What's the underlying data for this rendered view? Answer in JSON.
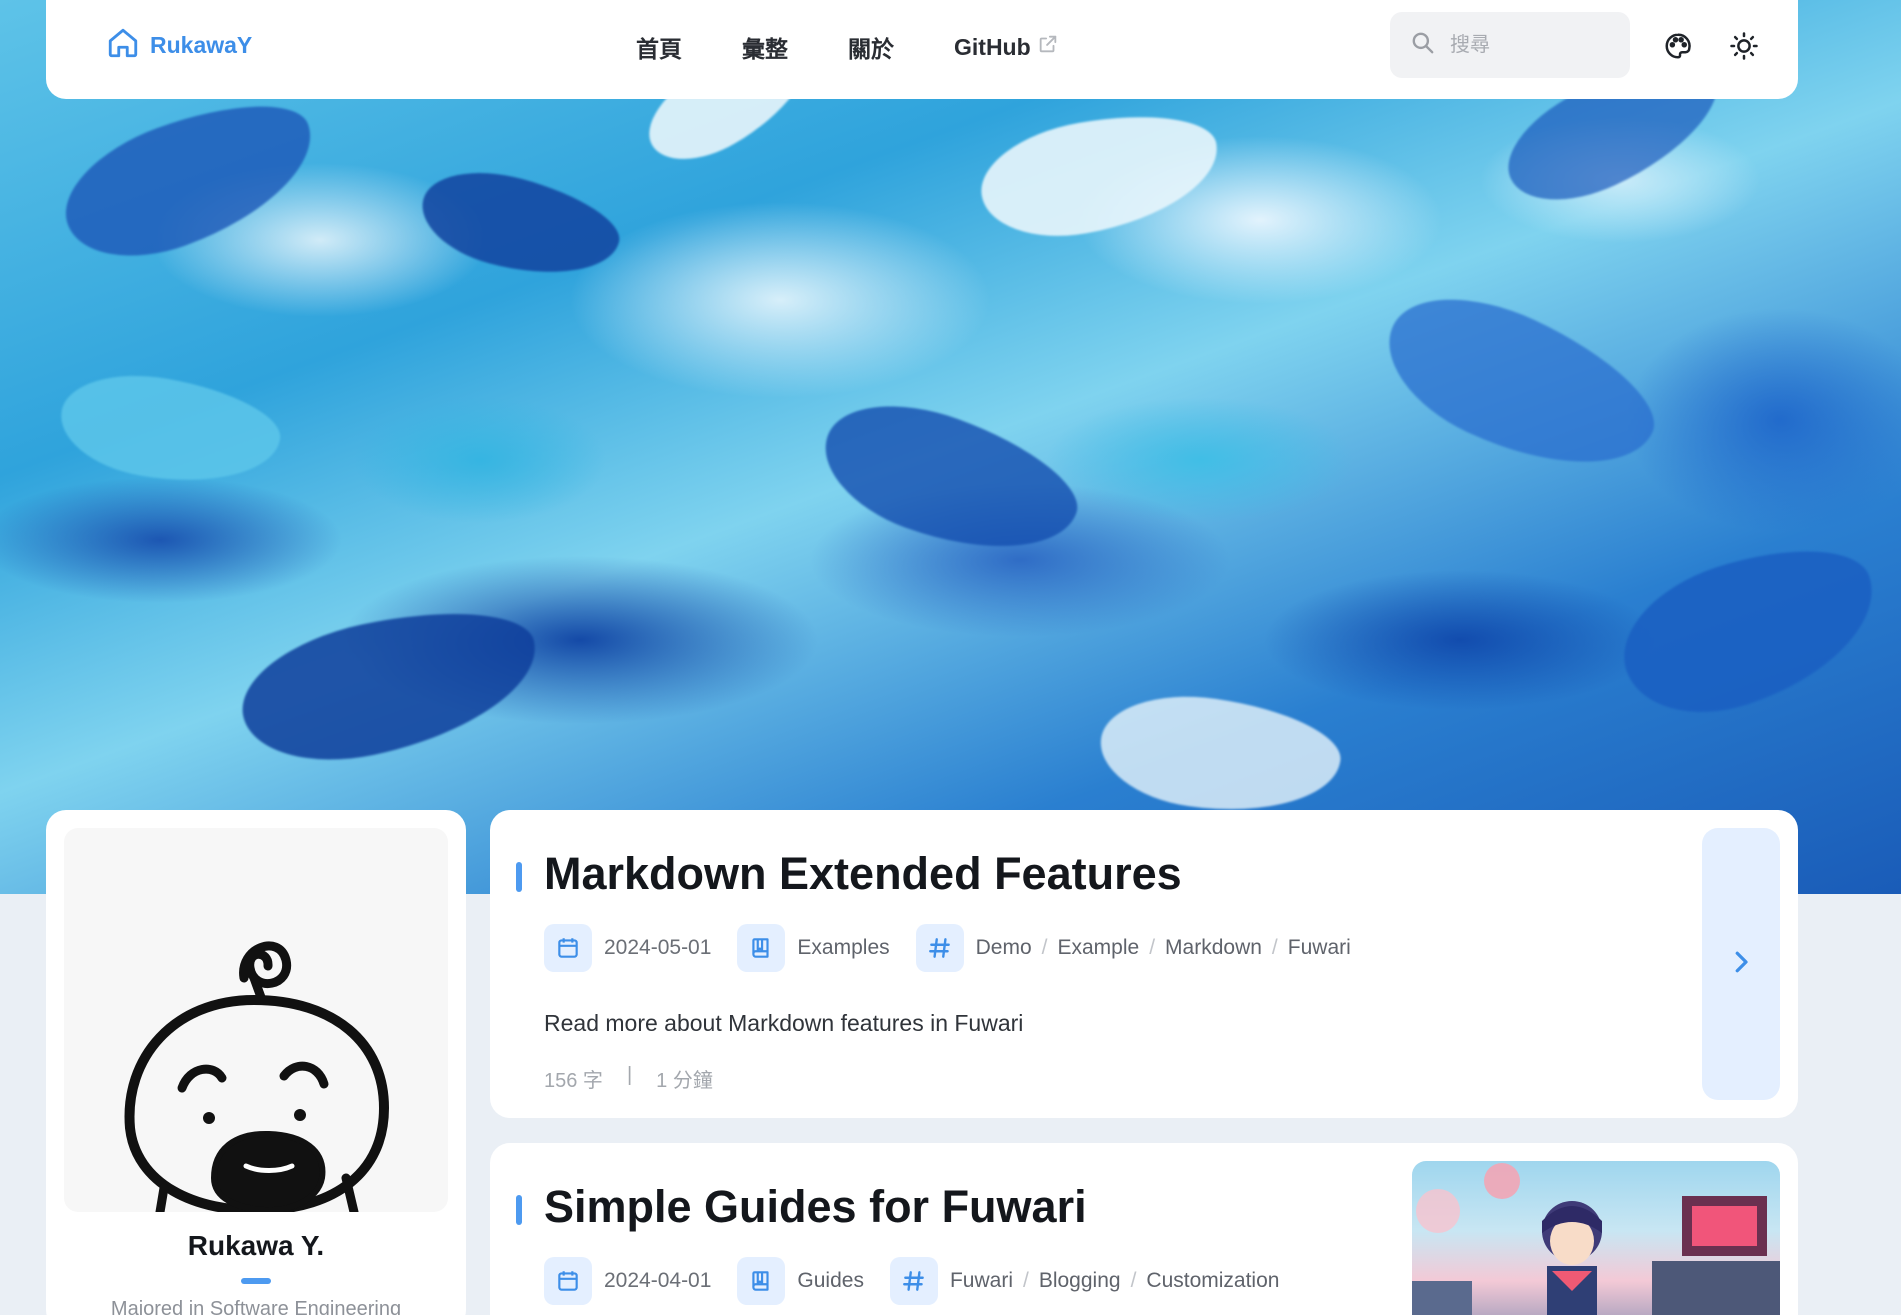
{
  "brand": {
    "name": "RukawaY",
    "icon": "home-icon"
  },
  "nav": {
    "links": [
      {
        "label": "首頁"
      },
      {
        "label": "彙整"
      },
      {
        "label": "關於"
      },
      {
        "label": "GitHub",
        "external": true
      }
    ]
  },
  "search": {
    "placeholder": "搜尋",
    "value": ""
  },
  "actions": {
    "theme_color": "palette-icon",
    "display_mode": "sun-icon"
  },
  "colors": {
    "accent": "#4d9af0",
    "accent_soft": "#e4efff",
    "page_bg": "#eaeff5"
  },
  "profile": {
    "name": "Rukawa Y.",
    "bio": "Majored in Software Engineering"
  },
  "posts": [
    {
      "title": "Markdown Extended Features",
      "date": "2024-05-01",
      "category": "Examples",
      "tags": [
        "Demo",
        "Example",
        "Markdown",
        "Fuwari"
      ],
      "description": "Read more about Markdown features in Fuwari",
      "words": "156 字",
      "reading_time": "1 分鐘",
      "stat_divider": "|"
    },
    {
      "title": "Simple Guides for Fuwari",
      "date": "2024-04-01",
      "category": "Guides",
      "tags": [
        "Fuwari",
        "Blogging",
        "Customization"
      ],
      "has_cover": true
    }
  ],
  "tag_separator": "/"
}
